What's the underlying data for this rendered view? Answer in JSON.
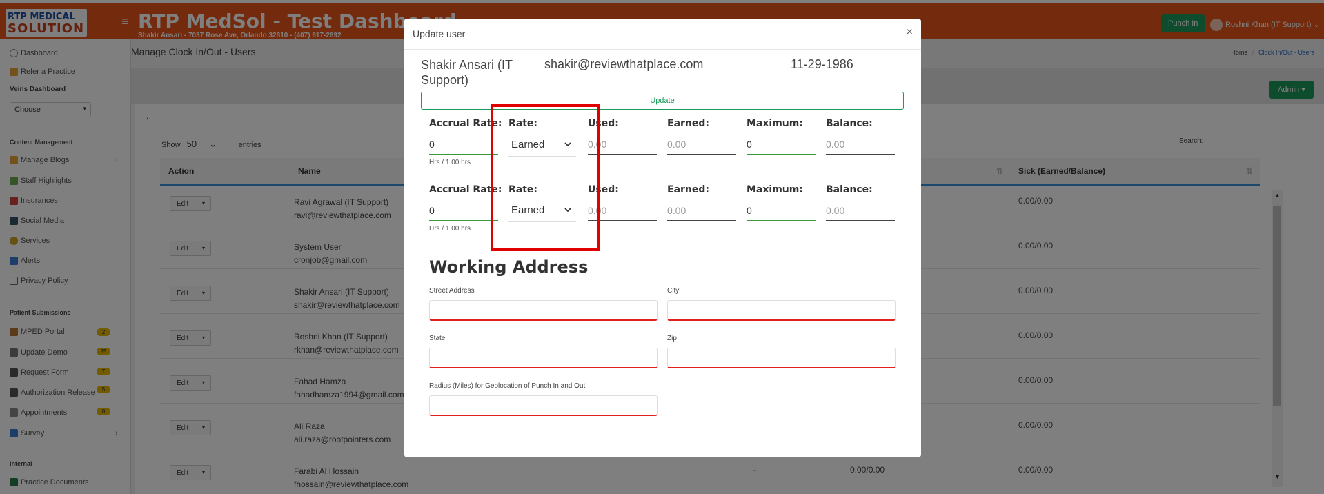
{
  "header": {
    "logo_line1": "RTP MEDICAL",
    "logo_line2": "SOLUTION",
    "title": "RTP MedSol - Test Dashboard",
    "subtitle": "Shakir Ansari - 7037 Rose Ave, Orlando 32810 - (407) 617-2692",
    "punch_in": "Punch In",
    "user": "Roshni Khan (IT Support)"
  },
  "sidebar": {
    "dashboard": "Dashboard",
    "refer": "Refer a Practice",
    "veins": "Veins Dashboard",
    "choose": "Choose",
    "content_mgmt": "Content Management",
    "manage_blogs": "Manage Blogs",
    "staff": "Staff Highlights",
    "insurances": "Insurances",
    "social": "Social Media",
    "services": "Services",
    "alerts": "Alerts",
    "privacy": "Privacy Policy",
    "patient_sub": "Patient Submissions",
    "mped": "MPED Portal",
    "mped_badge": "2",
    "update_demo": "Update Demo",
    "update_demo_badge": "25",
    "request_form": "Request Form",
    "request_form_badge": "7",
    "auth_release": "Authorization Release",
    "auth_release_badge": "5",
    "appointments": "Appointments",
    "appointments_badge": "8",
    "survey": "Survey",
    "internal": "Internal",
    "practice_docs": "Practice Documents"
  },
  "content": {
    "page_title": "Manage Clock In/Out - Users",
    "crumb_home": "Home",
    "crumb_sep": "/",
    "crumb_active": "Clock In/Out - Users",
    "admin_btn": "Admin",
    "dot": ".",
    "show": "Show",
    "show_count": "50",
    "entries": "entries",
    "search": "Search:",
    "col_action": "Action",
    "col_name": "Name",
    "col_sick": "Sick (Earned/Balance)",
    "edit": "Edit",
    "rows": [
      {
        "name": "Ravi Agrawal (IT Support)",
        "email": "ravi@reviewthatplace.com",
        "sick": "0.00/0.00"
      },
      {
        "name": "System User",
        "email": "cronjob@gmail.com",
        "sick": "0.00/0.00"
      },
      {
        "name": "Shakir Ansari (IT Support)",
        "email": "shakir@reviewthatplace.com",
        "sick": "0.00/0.00"
      },
      {
        "name": "Roshni Khan (IT Support)",
        "email": "rkhan@reviewthatplace.com",
        "sick": "0.00/0.00"
      },
      {
        "name": "Fahad Hamza",
        "email": "fahadhamza1994@gmail.com",
        "sick": "0.00/0.00"
      },
      {
        "name": "Ali Raza",
        "email": "ali.raza@rootpointers.com",
        "sick": "0.00/0.00"
      },
      {
        "name": "Farabi Al Hossain",
        "email": "fhossain@reviewthatplace.com",
        "sick": "0.00/0.00",
        "dash": "-",
        "mid": "0.00/0.00"
      }
    ]
  },
  "modal": {
    "title": "Update user",
    "close": "×",
    "user_name": "Shakir Ansari (IT Support)",
    "user_email": "shakir@reviewthatplace.com",
    "user_dob": "11-29-1986",
    "update_btn": "Update",
    "accrual_label": "Accrual Rate:",
    "rate_label": "Rate:",
    "used_label": "Used:",
    "earned_label": "Earned:",
    "maximum_label": "Maximum:",
    "balance_label": "Balance:",
    "hint": "Hrs / 1.00 hrs",
    "row1": {
      "accrual": "0",
      "rate": "Earned",
      "used": "0.00",
      "earned": "0.00",
      "maximum": "0",
      "balance": "0.00"
    },
    "row2": {
      "accrual": "0",
      "rate": "Earned",
      "used": "0.00",
      "earned": "0.00",
      "maximum": "0",
      "balance": "0.00"
    },
    "working_address": "Working Address",
    "street_label": "Street Address",
    "city_label": "City",
    "state_label": "State",
    "zip_label": "Zip",
    "radius_label": "Radius (Miles) for Geolocation of Punch In and Out"
  },
  "colors": {
    "brand_orange": "#e8561b",
    "accent_green": "#1a9a5a",
    "highlight_red": "#e00000"
  }
}
